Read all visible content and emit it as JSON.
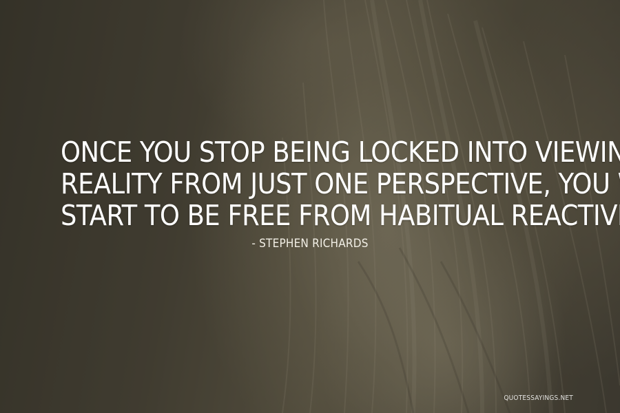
{
  "quote": {
    "lines": [
      "ONCE YOU STOP BEING LOCKED INTO VIEWING",
      "REALITY FROM JUST ONE PERSPECTIVE, YOU WILL",
      "START TO BE FREE FROM HABITUAL REACTIVITY."
    ],
    "author": "- STEPHEN RICHARDS"
  },
  "watermark": "QUOTESSAYINGS.NET",
  "colors": {
    "text": "#ffffff",
    "background_dark": "#3d3a2f",
    "background_light": "#b4aa8c"
  }
}
